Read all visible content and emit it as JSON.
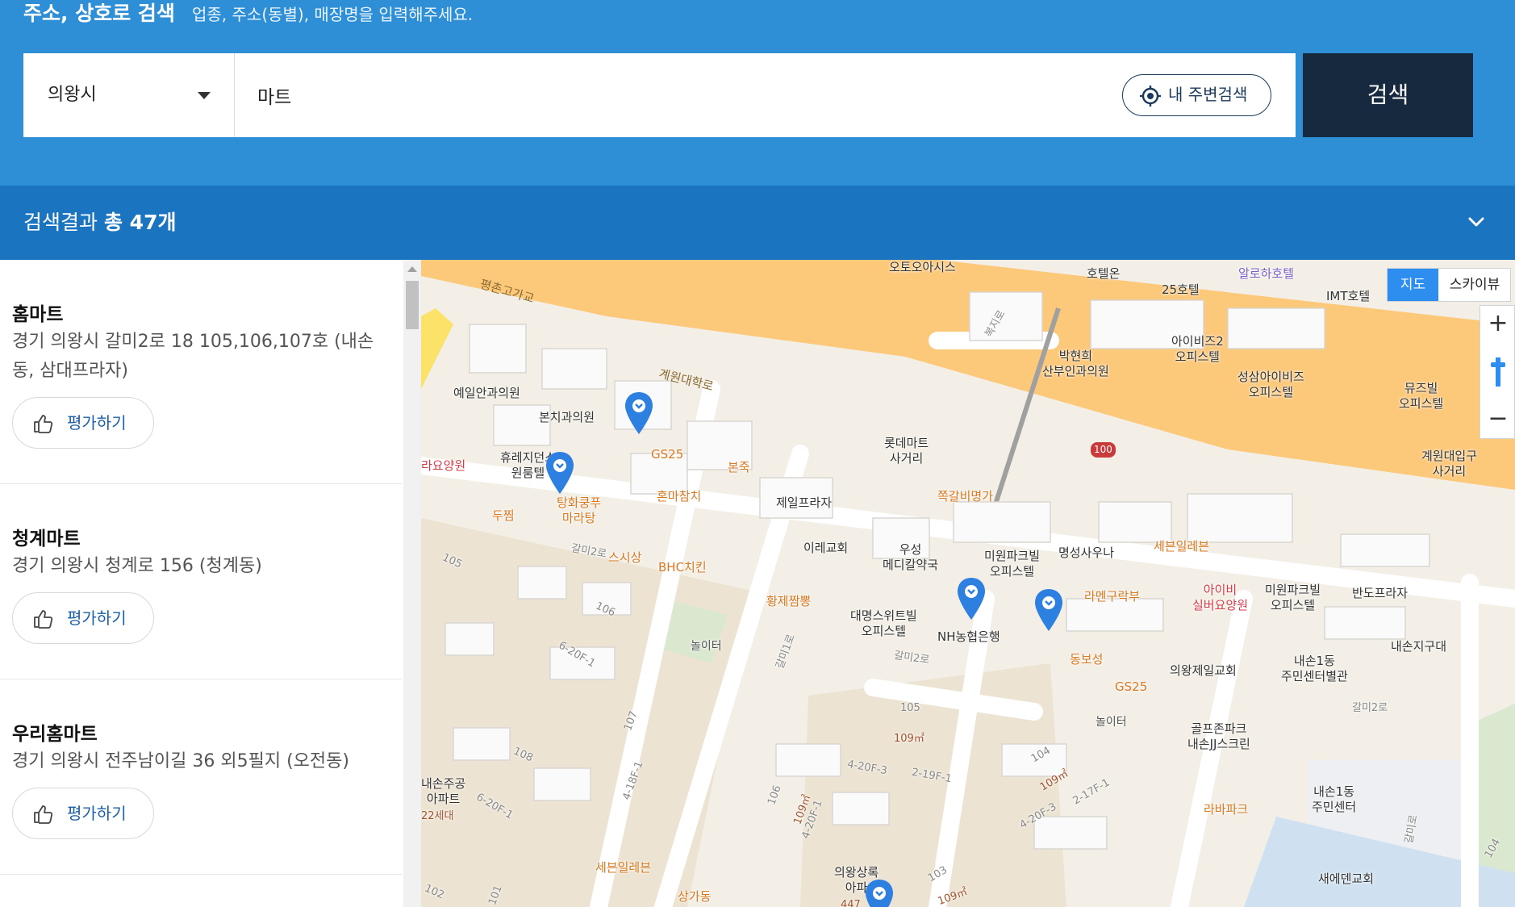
{
  "header": {
    "title": "주소, 상호로 검색",
    "hint": "업종, 주소(동별), 매장명을 입력해주세요."
  },
  "search": {
    "region": "의왕시",
    "keyword": "마트",
    "nearby_label": "내 주변검색",
    "button_label": "검색"
  },
  "results": {
    "prefix": "검색결과",
    "count_label": "총 47개"
  },
  "stores": [
    {
      "name": "홈마트",
      "address": "경기 의왕시 갈미2로 18 105,106,107호 (내손동, 삼대프라자)",
      "rate_label": "평가하기"
    },
    {
      "name": "청계마트",
      "address": "경기 의왕시 청계로 156 (청계동)",
      "rate_label": "평가하기"
    },
    {
      "name": "우리홈마트",
      "address": "경기 의왕시 전주남이길 36 외5필지 (오전동)",
      "rate_label": "평가하기"
    }
  ],
  "map": {
    "type_map": "지도",
    "type_sky": "스카이뷰",
    "zoom_in": "+",
    "zoom_out": "−",
    "labels": {
      "pyeongchon": "평촌고가교",
      "gyewon_univ_ro": "계원대학로",
      "oto_oasis": "오토오아시스",
      "hotelon": "호텔온",
      "hotel25": "25호텔",
      "aloha": "알로하호텔",
      "imt": "IMT호텔",
      "bukji_ro": "복지로",
      "bakhyunhee": "박현희\n산부인과의원",
      "ibiz2": "아이비즈2\n오피스텔",
      "seongsam": "성삼아이비즈\n오피스텔",
      "muse": "뮤즈빌\n오피스텔",
      "gyewon_entrance": "계원대입구\n사거리",
      "yeil": "예일안과의원",
      "bonchi": "본치과의원",
      "gs25_a": "GS25",
      "bonjuk": "본죽",
      "lotte": "롯데마트\n사거리",
      "route100": "100",
      "rara": "라요양원",
      "hure": "휴레지던스\n원룸텔",
      "tanghwa": "탕화쿵푸\n마라탕",
      "honma": "혼마참치",
      "jeil": "제일프라자",
      "jjok": "쪽갈비명가",
      "dujjim": "두찜",
      "sesang": "스시상",
      "bhc": "BHC치킨",
      "irae": "이레교회",
      "woosung": "우성\n메디칼약국",
      "miwon1": "미원파크빌\n오피스텔",
      "myeongseong": "명성사우나",
      "seven_a": "세븐일레븐",
      "ibi": "아이비\n실버요양원",
      "miwon2": "미원파크빌\n오피스텔",
      "bando": "반도프라자",
      "hwangje": "황제짬뽕",
      "daemyeong": "대명스위트빌\n오피스텔",
      "nh": "NH농협은행",
      "ramen": "라멘구락부",
      "nolite_a": "놀이터",
      "dongbo": "동보성",
      "gs25_b": "GS25",
      "uiwang_church": "의왕제일교회",
      "naeson_center": "내손1동\n주민센터별관",
      "naeson_squad": "내손지구대",
      "galmi2ro_a": "갈미2로",
      "galmi2ro_b": "갈미2로",
      "galmi2ro_c": "갈미2로",
      "galmi1ro": "갈미1로",
      "golf": "골프존파크\n내손JJ스크린",
      "laba": "라바파크",
      "naeson1": "내손1동\n주민센터",
      "nolite_b": "놀이터",
      "naeson_apt": "내손주공\n아파트",
      "seven_b": "세븐일레븐",
      "sangga": "상가동",
      "uiwang_lotte": "의왕상록\n아파",
      "newheaven": "새에덴교회",
      "galmi_ro_v": "갈미로",
      "d105": "105",
      "d106": "106",
      "d107": "107",
      "d108": "108",
      "d105b": "105",
      "d106b": "106",
      "d104": "104",
      "d103": "103",
      "d104b": "104",
      "d102": "102",
      "d101": "101",
      "f1": "6-20F-1",
      "f2": "4-18F-1",
      "f3": "4-20F-3",
      "f4": "2-19F-1",
      "f5": "2-17F-1",
      "f6": "4-20F-3",
      "f7": "4-20F-1",
      "f8": "6-20F-1",
      "m1": "109㎡",
      "m2": "109㎡",
      "m3": "109㎡",
      "m4": "109㎡",
      "hh": "22세대",
      "hh2": "447"
    }
  },
  "colors": {
    "header_bg": "#2f8fd6",
    "results_bar_bg": "#1a74c0",
    "search_button_bg": "#16293f",
    "highway": "#fcc87a",
    "pin": "#2d7fe0",
    "map_type_active": "#2e8ef0"
  },
  "icons": {
    "region_dropdown": "caret-down-icon",
    "nearby": "location-target-icon",
    "collapse": "chevron-down-icon",
    "rate": "thumbs-up-icon",
    "map_pin": "map-pin-icon"
  }
}
